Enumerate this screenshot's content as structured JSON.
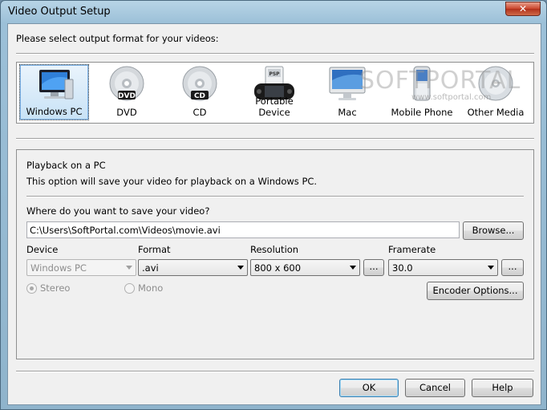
{
  "window": {
    "title": "Video Output Setup",
    "close_symbol": "✕"
  },
  "prompt": "Please select output format for your videos:",
  "formats": [
    {
      "label": "Windows PC",
      "icon": "monitor-icon"
    },
    {
      "label": "DVD",
      "icon": "dvd-disc-icon",
      "badge": "DVD"
    },
    {
      "label": "CD",
      "icon": "cd-disc-icon",
      "badge": "CD"
    },
    {
      "label": "Portable Device",
      "icon": "psp-icon",
      "badge": "PSP"
    },
    {
      "label": "Mac",
      "icon": "imac-icon"
    },
    {
      "label": "Mobile Phone",
      "icon": "phone-icon"
    },
    {
      "label": "Other Media",
      "icon": "disc-icon"
    }
  ],
  "selected_format": "Windows PC",
  "watermark": {
    "main": "SOFTPORTAL",
    "sub": "www.softportal.com"
  },
  "panel": {
    "heading": "Playback on a PC",
    "description": "This option will save your video for playback on a Windows PC.",
    "save_question": "Where do you want to save your video?",
    "save_path": "C:\\Users\\SoftPortal.com\\Videos\\movie.avi",
    "browse_label": "Browse...",
    "device_label": "Device",
    "device_value": "Windows PC",
    "format_label": "Format",
    "format_value": ".avi",
    "resolution_label": "Resolution",
    "resolution_value": "800 x 600",
    "resolution_more": "...",
    "framerate_label": "Framerate",
    "framerate_value": "30.0",
    "framerate_more": "...",
    "stereo_label": "Stereo",
    "mono_label": "Mono",
    "encoder_label": "Encoder Options..."
  },
  "footer": {
    "ok": "OK",
    "cancel": "Cancel",
    "help": "Help"
  }
}
